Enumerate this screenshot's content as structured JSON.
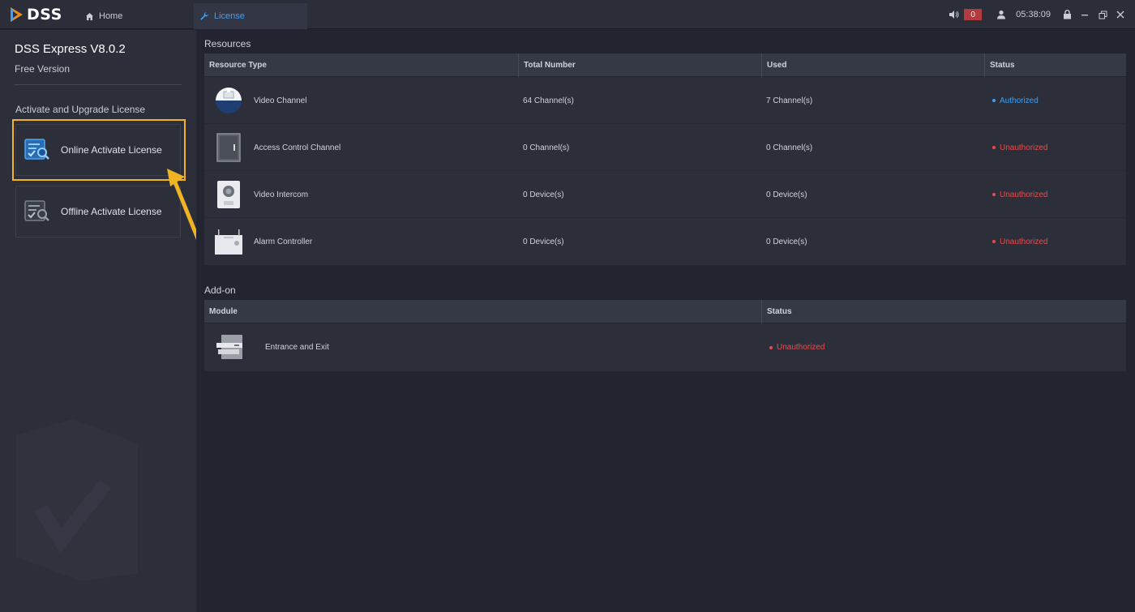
{
  "app": {
    "logo_text": "DSS"
  },
  "tabs": [
    {
      "label": "Home",
      "icon": "home-icon"
    },
    {
      "label": "License",
      "icon": "wrench-icon"
    }
  ],
  "topbar": {
    "alarm_count": "0",
    "time": "05:38:09"
  },
  "sidebar": {
    "product_name": "DSS Express V8.0.2",
    "version": "Free Version",
    "section_title": "Activate and Upgrade License",
    "online_label": "Online Activate License",
    "offline_label": "Offline Activate License"
  },
  "resources": {
    "title": "Resources",
    "headers": [
      "Resource Type",
      "Total Number",
      "Used",
      "Status"
    ],
    "rows": [
      {
        "type": "Video Channel",
        "total": "64 Channel(s)",
        "used": "7 Channel(s)",
        "status": "Authorized",
        "icon": "camera-icon"
      },
      {
        "type": "Access Control Channel",
        "total": "0 Channel(s)",
        "used": "0 Channel(s)",
        "status": "Unauthorized",
        "icon": "door-icon"
      },
      {
        "type": "Video Intercom",
        "total": "0 Device(s)",
        "used": "0 Device(s)",
        "status": "Unauthorized",
        "icon": "intercom-icon"
      },
      {
        "type": "Alarm Controller",
        "total": "0 Device(s)",
        "used": "0 Device(s)",
        "status": "Unauthorized",
        "icon": "alarm-controller-icon"
      }
    ]
  },
  "addon": {
    "title": "Add-on",
    "headers": [
      "Module",
      "Status"
    ],
    "rows": [
      {
        "module": "Entrance and Exit",
        "status": "Unauthorized",
        "icon": "barrier-gate-icon"
      }
    ]
  },
  "colors": {
    "authorized": "#3da0f5",
    "unauthorized": "#e84b4b",
    "highlight": "#f0b323"
  }
}
